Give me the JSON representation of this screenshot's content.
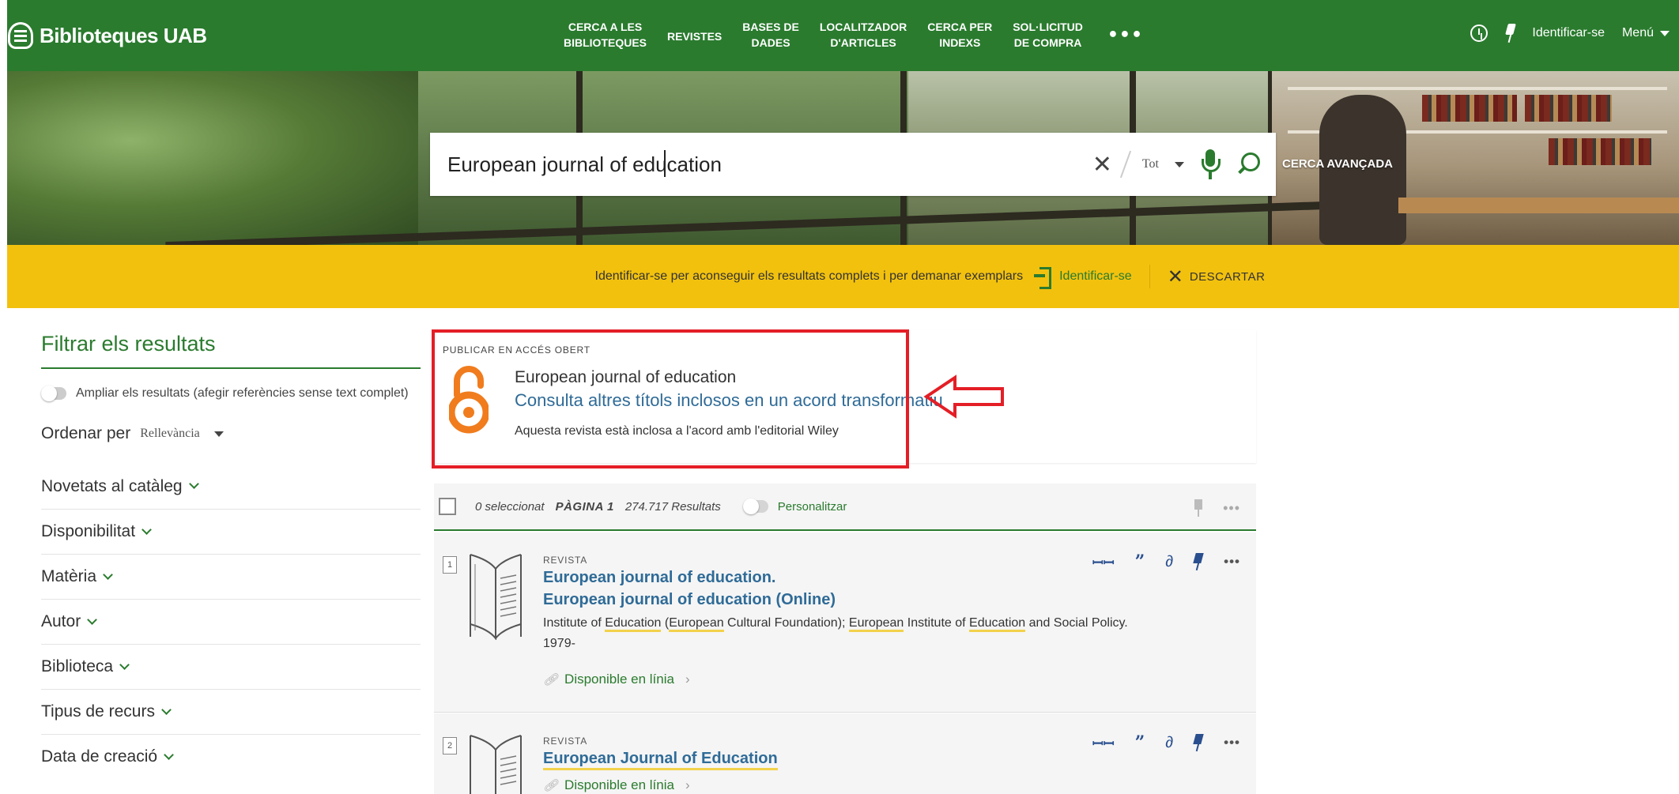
{
  "header": {
    "brand": "Biblioteques UAB",
    "nav": [
      "CERCA A LES\nBIBLIOTEQUES",
      "REVISTES",
      "BASES DE\nDADES",
      "LOCALITZADOR\nD'ARTICLES",
      "CERCA PER\nINDEXS",
      "SOL·LICITUD\nDE COMPRA"
    ],
    "more": "•••",
    "login": "Identificar-se",
    "menu": "Menú"
  },
  "search": {
    "value": "European journal of education",
    "scope": "Tot",
    "advanced": "CERCA AVANÇADA"
  },
  "banner": {
    "message": "Identificar-se per aconseguir els resultats complets i per demanar exemplars",
    "login": "Identificar-se",
    "dismiss": "DESCARTAR"
  },
  "sidebar": {
    "title": "Filtrar els resultats",
    "expand": "Ampliar els resultats (afegir referències sense text complet)",
    "sort_label": "Ordenar per",
    "sort_value": "Rellevància",
    "facets": [
      "Novetats al catàleg",
      "Disponibilitat",
      "Matèria",
      "Autor",
      "Biblioteca",
      "Tipus de recurs",
      "Data de creació"
    ]
  },
  "open_access": {
    "label": "PUBLICAR EN ACCÉS OBERT",
    "title": "European journal of education",
    "link": "Consulta altres títols inclosos en un acord transformatiu",
    "note": "Aquesta revista està inclosa a l'acord amb l'editorial Wiley"
  },
  "results_header": {
    "selected": "0 seleccionat",
    "page": "PÀGINA 1",
    "count": "274.717 Resultats",
    "personalize": "Personalitzar"
  },
  "results": [
    {
      "num": "1",
      "type": "REVISTA",
      "title1": "European journal of education.",
      "title2": "European journal of education (Online)",
      "authors": {
        "a": "Institute of ",
        "b": "Education",
        "c": " (",
        "d": "European",
        "e": " Cultural Foundation); ",
        "f": "European",
        "g": " Institute of ",
        "h": "Education",
        "i": " and Social Policy."
      },
      "year": "1979-",
      "availability": "Disponible en línia"
    },
    {
      "num": "2",
      "type": "REVISTA",
      "title1": "European Journal of Education",
      "availability": "Disponible en línia"
    }
  ]
}
